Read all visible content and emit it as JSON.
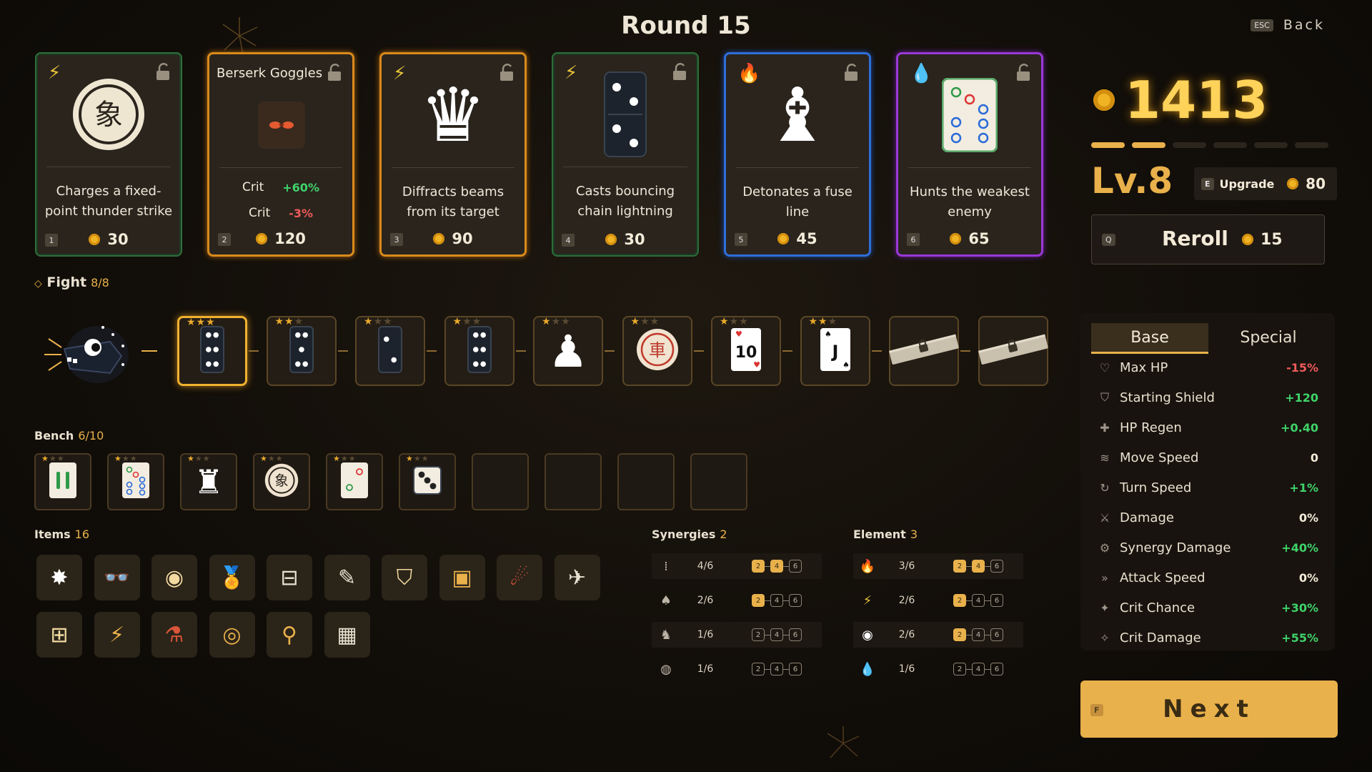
{
  "header": {
    "title": "Round 15",
    "back_key": "ESC",
    "back_label": "Back"
  },
  "shop": [
    {
      "slot": "1",
      "rarity": "green",
      "element": "lightning",
      "art": "xiangqi-elephant",
      "glyph": "象",
      "desc": "Charges a fixed-point thunder strike",
      "price": "30"
    },
    {
      "slot": "2",
      "rarity": "orange",
      "name": "Berserk Goggles",
      "art": "goggles",
      "stats": [
        {
          "label": "Crit",
          "value": "+60%"
        },
        {
          "label": "Crit",
          "value": "-3%"
        }
      ],
      "price": "120"
    },
    {
      "slot": "3",
      "rarity": "orange",
      "element": "lightning",
      "art": "chess-queen",
      "glyph": "♛",
      "desc": "Diffracts beams from its target",
      "price": "90"
    },
    {
      "slot": "4",
      "rarity": "green",
      "element": "lightning",
      "art": "domino-2-2",
      "desc": "Casts bouncing chain lightning",
      "price": "30"
    },
    {
      "slot": "5",
      "rarity": "blue",
      "element": "fire",
      "art": "chess-bishop",
      "glyph": "♝",
      "desc": "Detonates a fuse line",
      "price": "45"
    },
    {
      "slot": "6",
      "rarity": "purple",
      "element": "water",
      "art": "mahjong-dots",
      "desc": "Hunts the weakest enemy",
      "price": "65"
    }
  ],
  "player": {
    "gold": "1413",
    "xp_pips_filled": 2,
    "xp_pips_total": 6,
    "level": "Lv.8",
    "upgrade_key": "E",
    "upgrade_label": "Upgrade",
    "upgrade_cost": "80",
    "reroll_key": "Q",
    "reroll_label": "Reroll",
    "reroll_cost": "15"
  },
  "fight": {
    "label": "Fight",
    "count": "8/8",
    "slots": [
      {
        "stars": 3,
        "piece": "domino-6",
        "selected": true
      },
      {
        "stars": 2,
        "piece": "domino-5"
      },
      {
        "stars": 1,
        "piece": "domino-2"
      },
      {
        "stars": 1,
        "piece": "domino-6"
      },
      {
        "stars": 1,
        "piece": "chess-pawn",
        "glyph": "♟"
      },
      {
        "stars": 1,
        "piece": "xiangqi-chariot",
        "glyph": "車"
      },
      {
        "stars": 1,
        "piece": "card-10-hearts",
        "glyph": "10"
      },
      {
        "stars": 2,
        "piece": "card-j-spades",
        "glyph": "J"
      },
      {
        "stars": 0,
        "piece": "locked"
      },
      {
        "stars": 0,
        "piece": "locked"
      }
    ]
  },
  "bench": {
    "label": "Bench",
    "count": "6/10",
    "slots": [
      {
        "stars": 1,
        "piece": "mahjong-bamboo"
      },
      {
        "stars": 1,
        "piece": "mahjong-dots"
      },
      {
        "stars": 1,
        "piece": "chess-rook",
        "glyph": "♜"
      },
      {
        "stars": 1,
        "piece": "xiangqi-elephant",
        "glyph": "象"
      },
      {
        "stars": 1,
        "piece": "mahjong-dots-2"
      },
      {
        "stars": 1,
        "piece": "die-3"
      },
      {
        "stars": 0,
        "piece": "empty"
      },
      {
        "stars": 0,
        "piece": "empty"
      },
      {
        "stars": 0,
        "piece": "empty"
      },
      {
        "stars": 0,
        "piece": "empty"
      }
    ]
  },
  "items": {
    "label": "Items",
    "count": "16",
    "list": [
      {
        "icon": "burst-icon",
        "glyph": "✸",
        "color": "#ffffff"
      },
      {
        "icon": "goggles-icon",
        "glyph": "👓",
        "color": "#e8e0d0"
      },
      {
        "icon": "ring-icon",
        "glyph": "◉",
        "color": "#f2d9a0"
      },
      {
        "icon": "medal-icon",
        "glyph": "🏅",
        "color": "#e9b14b"
      },
      {
        "icon": "dumbbell-icon",
        "glyph": "⊟",
        "color": "#e8e0d0"
      },
      {
        "icon": "wand-icon",
        "glyph": "✎",
        "color": "#e8e0d0"
      },
      {
        "icon": "lamp-icon",
        "glyph": "⛉",
        "color": "#f2d9a0"
      },
      {
        "icon": "canister-icon",
        "glyph": "▣",
        "color": "#e9b14b"
      },
      {
        "icon": "meteor-icon",
        "glyph": "☄",
        "color": "#d9553a"
      },
      {
        "icon": "bird-icon",
        "glyph": "✈",
        "color": "#e8e0d0"
      },
      {
        "icon": "tray-icon",
        "glyph": "⊞",
        "color": "#f2d9a0"
      },
      {
        "icon": "battery-icon",
        "glyph": "⚡",
        "color": "#e9b14b"
      },
      {
        "icon": "bottle-icon",
        "glyph": "⚗",
        "color": "#d9553a"
      },
      {
        "icon": "target-stick-icon",
        "glyph": "◎",
        "color": "#e9b14b"
      },
      {
        "icon": "matchstick-icon",
        "glyph": "⚲",
        "color": "#e9b14b"
      },
      {
        "icon": "grid-tile-icon",
        "glyph": "▦",
        "color": "#e8e0d0"
      }
    ]
  },
  "synergies": {
    "label": "Synergies",
    "count": "2",
    "rows": [
      {
        "icon": "domino-icon",
        "glyph": "⁞",
        "value": "4/6",
        "active": 2
      },
      {
        "icon": "spade-icon",
        "glyph": "♠",
        "value": "2/6",
        "active": 1
      },
      {
        "icon": "knight-icon",
        "glyph": "♞",
        "value": "1/6",
        "active": 0
      },
      {
        "icon": "xiangqi-icon",
        "glyph": "◍",
        "value": "1/6",
        "active": 0
      }
    ]
  },
  "elements": {
    "label": "Element",
    "count": "3",
    "rows": [
      {
        "icon": "fire-icon",
        "glyph": "🔥",
        "value": "3/6",
        "active": 2,
        "color": "#f07a2a"
      },
      {
        "icon": "lightning-icon",
        "glyph": "⚡",
        "value": "2/6",
        "active": 1,
        "color": "#e9c43a"
      },
      {
        "icon": "void-icon",
        "glyph": "◉",
        "value": "2/6",
        "active": 1,
        "color": "#ffffff"
      },
      {
        "icon": "water-icon",
        "glyph": "💧",
        "value": "1/6",
        "active": 0,
        "color": "#2fbf6a"
      }
    ],
    "tiers": [
      "2",
      "4",
      "6"
    ]
  },
  "stats": {
    "tab_base": "Base",
    "tab_special": "Special",
    "rows": [
      {
        "icon": "heart-icon",
        "glyph": "♡",
        "label": "Max HP",
        "value": "-15%",
        "color": "#ef5a5a"
      },
      {
        "icon": "shield-icon",
        "glyph": "⛉",
        "label": "Starting Shield",
        "value": "+120",
        "color": "#3fd36a"
      },
      {
        "icon": "regen-icon",
        "glyph": "✚",
        "label": "HP Regen",
        "value": "+0.40",
        "color": "#3fd36a"
      },
      {
        "icon": "speed-icon",
        "glyph": "≋",
        "label": "Move Speed",
        "value": "0",
        "color": "#f3ead8"
      },
      {
        "icon": "turn-icon",
        "glyph": "↻",
        "label": "Turn Speed",
        "value": "+1%",
        "color": "#3fd36a"
      },
      {
        "icon": "damage-icon",
        "glyph": "⚔",
        "label": "Damage",
        "value": "0%",
        "color": "#f3ead8"
      },
      {
        "icon": "gear-icon",
        "glyph": "⚙",
        "label": "Synergy Damage",
        "value": "+40%",
        "color": "#3fd36a"
      },
      {
        "icon": "chevrons-icon",
        "glyph": "»",
        "label": "Attack Speed",
        "value": "0%",
        "color": "#f3ead8"
      },
      {
        "icon": "sparkle-icon",
        "glyph": "✦",
        "label": "Crit Chance",
        "value": "+30%",
        "color": "#3fd36a"
      },
      {
        "icon": "sparkles-icon",
        "glyph": "✧",
        "label": "Crit Damage",
        "value": "+55%",
        "color": "#3fd36a"
      }
    ]
  },
  "footer": {
    "next_key": "F",
    "next_label": "Next"
  }
}
